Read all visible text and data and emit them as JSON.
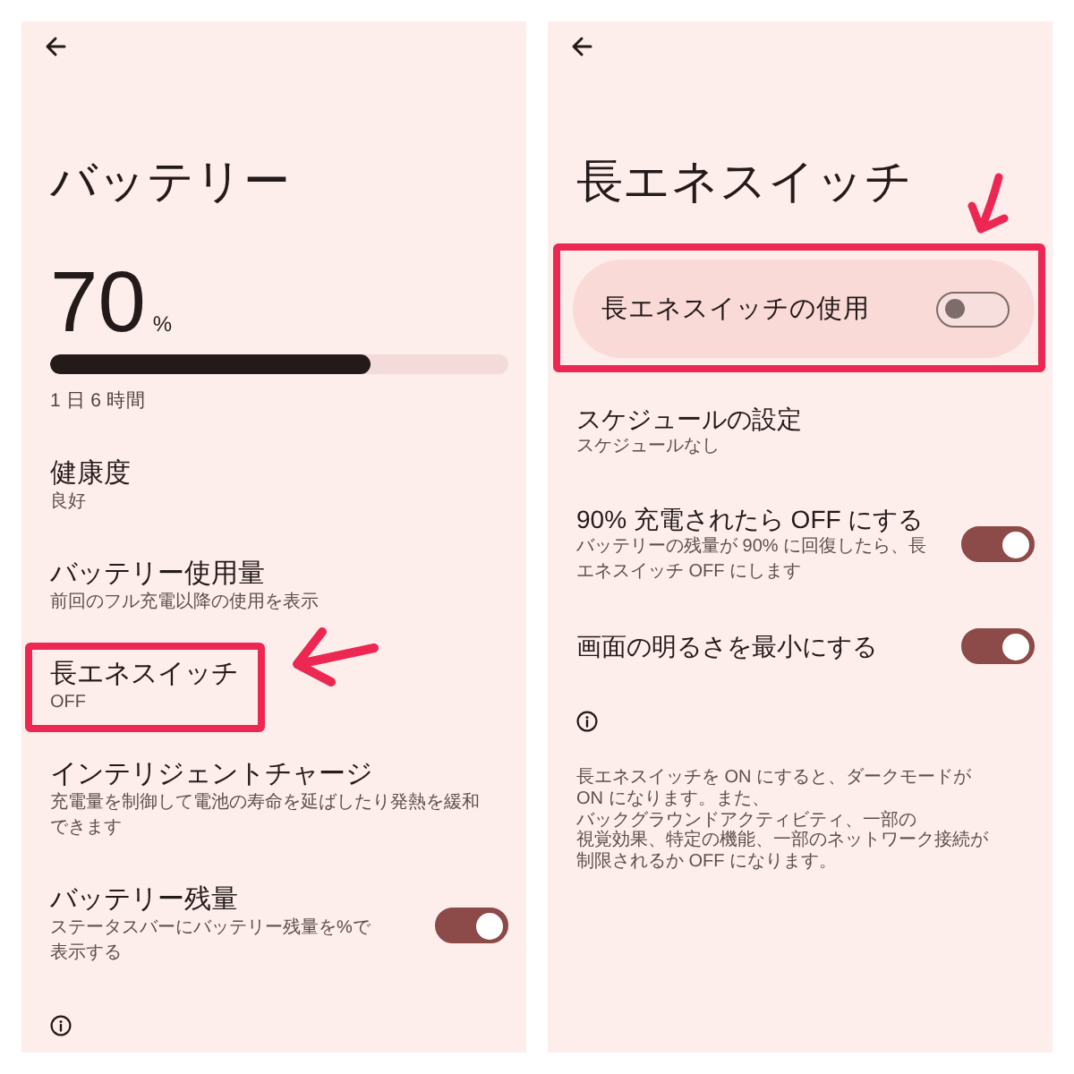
{
  "battery_screen": {
    "title": "バッテリー",
    "percentage": "70",
    "unit": "%",
    "meter": {
      "level": 0.7
    },
    "time_left": "1 日 6 時間",
    "items": [
      {
        "kind": "link",
        "title": "健康度",
        "subtitle": "良好",
        "highlighted": false
      },
      {
        "kind": "link",
        "title": "バッテリー使用量",
        "subtitle": "前回のフル充電以降の使用を表示",
        "highlighted": false
      },
      {
        "kind": "link",
        "title": "長エネスイッチ",
        "subtitle": "OFF",
        "highlighted": true
      },
      {
        "kind": "link",
        "title": "インテリジェントチャージ",
        "subtitle": "充電量を制御して電池の寿命を延ばしたり発熱を緩和できます",
        "highlighted": false
      },
      {
        "kind": "switch",
        "title": "バッテリー残量",
        "subtitle": "ステータスバーにバッテリー残量を%で表示する",
        "on": true,
        "highlighted": false
      }
    ]
  },
  "saver_screen": {
    "title": "長エネスイッチ",
    "main_switch": {
      "label": "長エネスイッチの使用",
      "on": false,
      "highlighted": true
    },
    "items": [
      {
        "kind": "link",
        "title": "スケジュールの設定",
        "subtitle": "スケジュールなし",
        "highlighted": false
      },
      {
        "kind": "switch",
        "title": "90% 充電されたら OFF にする",
        "subtitle": "バッテリーの残量が 90% に回復したら、長エネスイッチ OFF にします",
        "on": true,
        "highlighted": false
      },
      {
        "kind": "switch",
        "title": "画面の明るさを最小にする",
        "on": true,
        "highlighted": false
      }
    ],
    "footer": "長エネスイッチを ON にすると、ダークモードが ON になります。また、バックグラウンドアクティビティ、一部の視覚効果、特定の機能、一部のネットワーク接続が制限されるか OFF になります。"
  }
}
